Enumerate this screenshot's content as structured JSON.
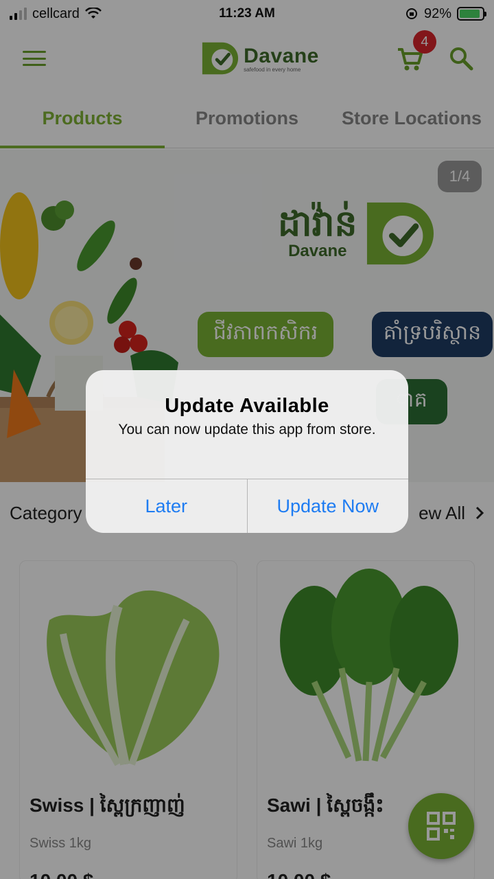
{
  "status_bar": {
    "carrier": "cellcard",
    "time": "11:23 AM",
    "battery": "92%",
    "battery_level": 0.92
  },
  "header": {
    "logo_name": "Davane",
    "logo_tagline": "safefood in every home",
    "cart_count": "4"
  },
  "tabs": [
    {
      "label": "Products",
      "active": true
    },
    {
      "label": "Promotions",
      "active": false
    },
    {
      "label": "Store Locations",
      "active": false
    }
  ],
  "banner": {
    "counter": "1/4",
    "brand_km": "ដាវ៉ាន់",
    "brand_en": "Davane",
    "pill_1": "ជីវភាពកសិករ",
    "pill_2": "គាំទ្របរិស្ថាន",
    "pill_3": "ាគ"
  },
  "category": {
    "label": "Category",
    "view_all": "ew All"
  },
  "products": [
    {
      "title": "Swiss | ស្ពៃក្រញាញ់",
      "subtitle": "Swiss 1kg",
      "price": "10.00 $"
    },
    {
      "title": "Sawi | ស្ពៃចង្កឹះ",
      "subtitle": "Sawi 1kg",
      "price": "10.00 $"
    }
  ],
  "dialog": {
    "title": "Update Available",
    "message": "You can now update this app from store.",
    "later": "Later",
    "update_now": "Update Now"
  },
  "colors": {
    "brand_green": "#7bb235",
    "dark_green": "#3e6b2a",
    "ios_blue": "#1e7cf2",
    "badge_red": "#d9262c"
  }
}
